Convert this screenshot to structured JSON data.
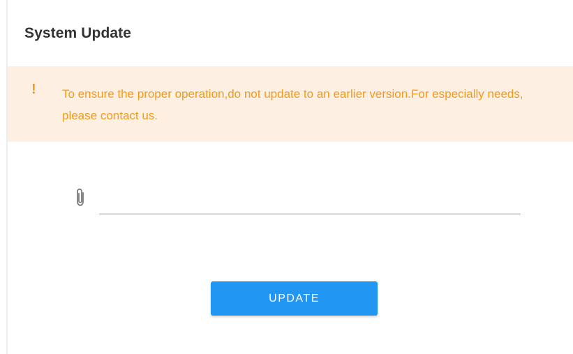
{
  "card": {
    "title": "System Update"
  },
  "alert": {
    "icon": "exclamation-icon",
    "icon_glyph": "!",
    "message": "To ensure the proper operation,do not update to an earlier version.For especially needs, please contact us.",
    "text_color": "#f29a1b",
    "background_color": "#fdefe2"
  },
  "file_input": {
    "icon": "paperclip-icon",
    "value": ""
  },
  "actions": {
    "update_label": "UPDATE",
    "button_color": "#2196f3"
  }
}
